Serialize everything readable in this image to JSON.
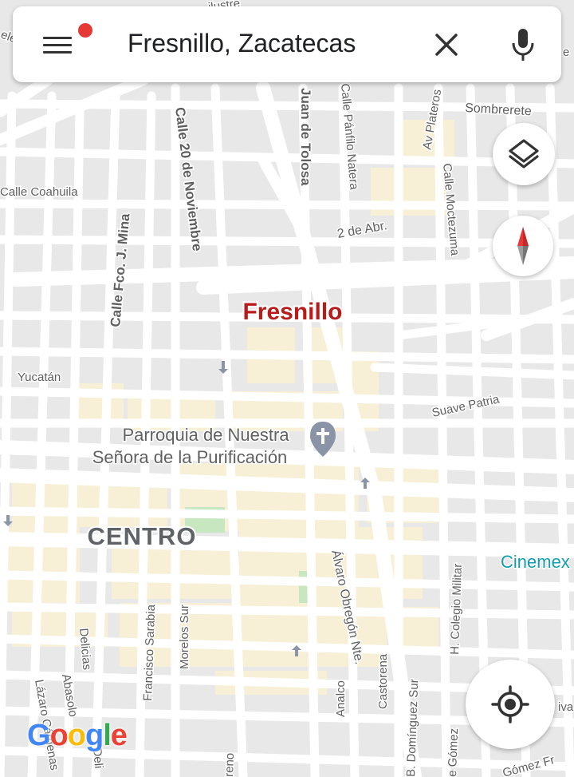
{
  "search": {
    "query": "Fresnillo, Zacatecas"
  },
  "map": {
    "city_label": "Fresnillo",
    "district_label": "CENTRO",
    "poi": {
      "line1": "Parroquia de Nuestra",
      "line2": "Señora de la Purificación"
    },
    "business_label": "Cinemex",
    "streets": {
      "calle_20_de_noviembre": "Calle 20 de Noviembre",
      "juan_de_tolosa": "Juan de Tolosa",
      "panfilo_natera": "Calle Pánfilo Natera",
      "av_plateros": "Av Plateros",
      "sombrerete": "Sombrerete",
      "calle_coahuila": "Calle Coahuila",
      "calle_fco_j_mina": "Calle Fco. J. Mina",
      "calle_moctezuma": "Calle Moctezuma",
      "dos_de_abr": "2 de Abr.",
      "yucatan": "Yucatán",
      "suave_patria": "Suave Patria",
      "alvaro_obregon": "Álvaro Obregón Nte.",
      "h_colegio_militar": "H. Colegio Militar",
      "delicias": "Delicias",
      "abasolo": "Abasolo",
      "francisco_sarabia": "Francisco Sarabia",
      "morelos_sur": "Morelos Sur",
      "castorena": "Castorena",
      "b_dominguez_sur": "B. Domínguez Sur",
      "analco": "Analco",
      "lazaro_cardenas": "Lázaro Cárdenas",
      "e_gomez": "e Gómez",
      "gomez_fr": "Gómez Fr",
      "moreno": "reno",
      "delicias_partial": "Deli",
      "ilustre": "ilustre",
      "eles": "eles",
      "te": "e",
      "iva": "iva"
    }
  },
  "google_logo": {
    "letters": [
      "G",
      "o",
      "o",
      "g",
      "l",
      "e"
    ]
  },
  "colors": {
    "accent_red": "#e53935",
    "city_label": "#b71c1c",
    "poi_label": "#616161",
    "business_label": "#129eaf",
    "district_label": "#5f6368",
    "block_gray": "#e8e8e8",
    "block_yellow": "#f8f0d6",
    "park_green": "#c7e7c1",
    "road": "#ffffff",
    "google_blue": "#4285F4",
    "google_red": "#EA4335",
    "google_yellow": "#FBBC05",
    "google_green": "#34A853"
  },
  "icons": {
    "menu": "hamburger-menu-icon",
    "clear": "close-icon",
    "mic": "microphone-icon",
    "layers": "layers-icon",
    "compass": "compass-icon",
    "locate": "my-location-icon",
    "poi": "church-pin-icon"
  }
}
